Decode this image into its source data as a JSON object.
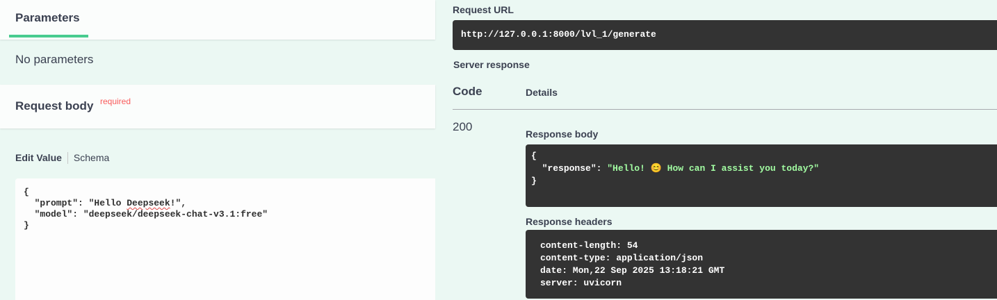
{
  "parameters": {
    "tab_label": "Parameters",
    "empty_text": "No parameters"
  },
  "request_body": {
    "title": "Request body",
    "required_label": "required",
    "tabs": {
      "edit_value": "Edit Value",
      "schema": "Schema"
    },
    "editor_lines": [
      "{",
      "  \"prompt\": \"Hello Deepseek!\",",
      "  \"model\": \"deepseek/deepseek-chat-v3.1:free\"",
      "}"
    ],
    "misspelled_word": "Deepseek"
  },
  "request_url": {
    "label": "Request URL",
    "value": "http://127.0.0.1:8000/lvl_1/generate"
  },
  "server_response": {
    "label": "Server response",
    "columns": {
      "code": "Code",
      "details": "Details"
    },
    "status_code": "200",
    "response_body": {
      "label": "Response body",
      "open_brace": "{",
      "key": "\"response\"",
      "separator": ": ",
      "value_before_emoji": "\"Hello! ",
      "emoji": "😊",
      "value_after_emoji": " How can I assist you today?\"",
      "close_brace": "}"
    },
    "response_headers": {
      "label": "Response headers",
      "lines": [
        "content-length: 54",
        "content-type: application/json",
        "date: Mon,22 Sep 2025 13:18:21 GMT",
        "server: uvicorn"
      ]
    }
  },
  "colors": {
    "background": "#ebf8f3",
    "accent": "#49cc90",
    "required": "#f93e3e",
    "code_bg": "#333333",
    "json_string": "#a2fca2"
  }
}
